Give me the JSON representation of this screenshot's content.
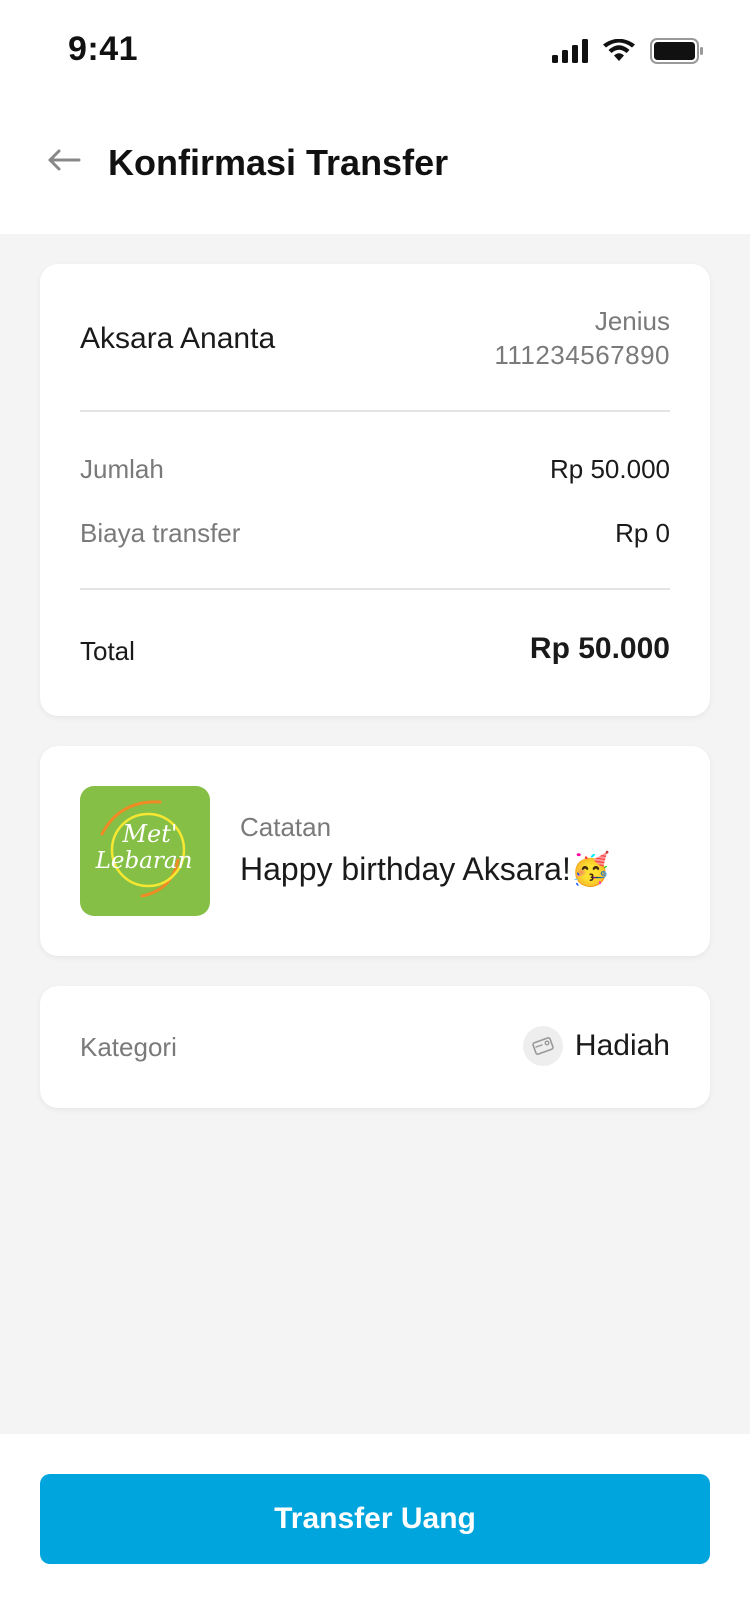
{
  "status_bar": {
    "time": "9:41",
    "icons": [
      "signal-icon",
      "wifi-icon",
      "battery-icon"
    ]
  },
  "header": {
    "title": "Konfirmasi Transfer",
    "back_icon": "arrow-left-icon"
  },
  "summary": {
    "recipient_name": "Aksara Ananta",
    "bank_name": "Jenius",
    "account_number": "111234567890",
    "amount_label": "Jumlah",
    "amount_value": "Rp 50.000",
    "fee_label": "Biaya transfer",
    "fee_value": "Rp 0",
    "total_label": "Total",
    "total_value": "Rp 50.000"
  },
  "note": {
    "thumbnail_text_line1": "Met'",
    "thumbnail_text_line2": "Lebaran",
    "label": "Catatan",
    "text": "Happy birthday Aksara!🥳"
  },
  "category": {
    "label": "Kategori",
    "value": "Hadiah",
    "icon": "gift-tag-icon"
  },
  "action": {
    "primary_label": "Transfer Uang"
  },
  "colors": {
    "primary": "#00a5de",
    "thumbnail_bg": "#86bf45",
    "page_bg": "#f4f4f4",
    "muted_text": "#7a7a7a"
  }
}
